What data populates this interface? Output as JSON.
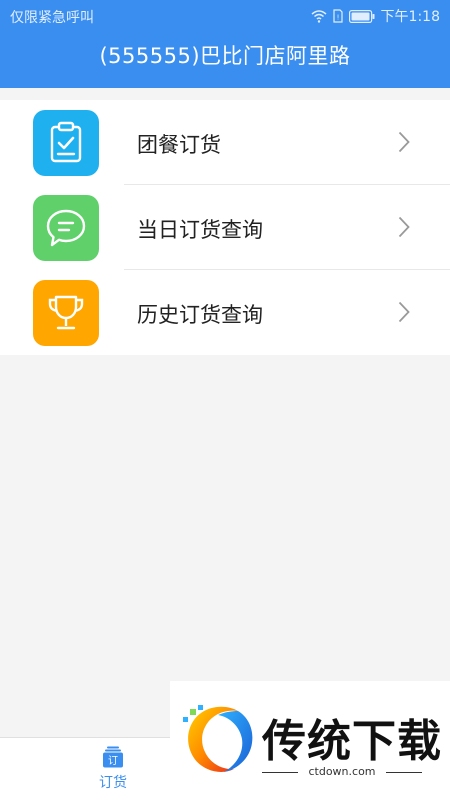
{
  "status_bar": {
    "left_text": "仅限紧急呼叫",
    "time": "下午1:18"
  },
  "header": {
    "title": "(555555)巴比门店阿里路"
  },
  "menu": {
    "items": [
      {
        "label": "团餐订货",
        "icon": "clipboard-check-icon",
        "color": "#1fb1ef"
      },
      {
        "label": "当日订货查询",
        "icon": "chat-bubble-icon",
        "color": "#5fd06a"
      },
      {
        "label": "历史订货查询",
        "icon": "trophy-icon",
        "color": "#ffa600"
      }
    ]
  },
  "tabbar": {
    "tabs": [
      {
        "label": "订货",
        "icon_text": "订",
        "active": true
      }
    ]
  },
  "watermark": {
    "text": "传统下载",
    "domain": "ctdown.com"
  },
  "colors": {
    "primary": "#3a8ef0",
    "background": "#f4f4f4"
  }
}
